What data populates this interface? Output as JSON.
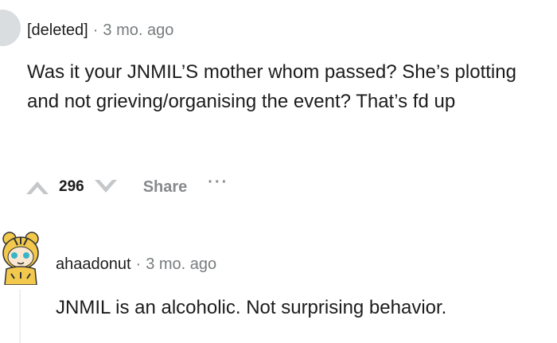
{
  "comments": [
    {
      "author": "[deleted]",
      "separator": "·",
      "time": "3 mo. ago",
      "body": "Was it your JNMIL’S mother whom passed? She’s plotting and not grieving/organising the event? That’s fd up",
      "votes": "296",
      "share_label": "Share",
      "more_label": "···"
    },
    {
      "author": "ahaadonut",
      "separator": "·",
      "time": "3 mo. ago",
      "body": "JNMIL is an alcoholic. Not surprising behavior."
    }
  ]
}
